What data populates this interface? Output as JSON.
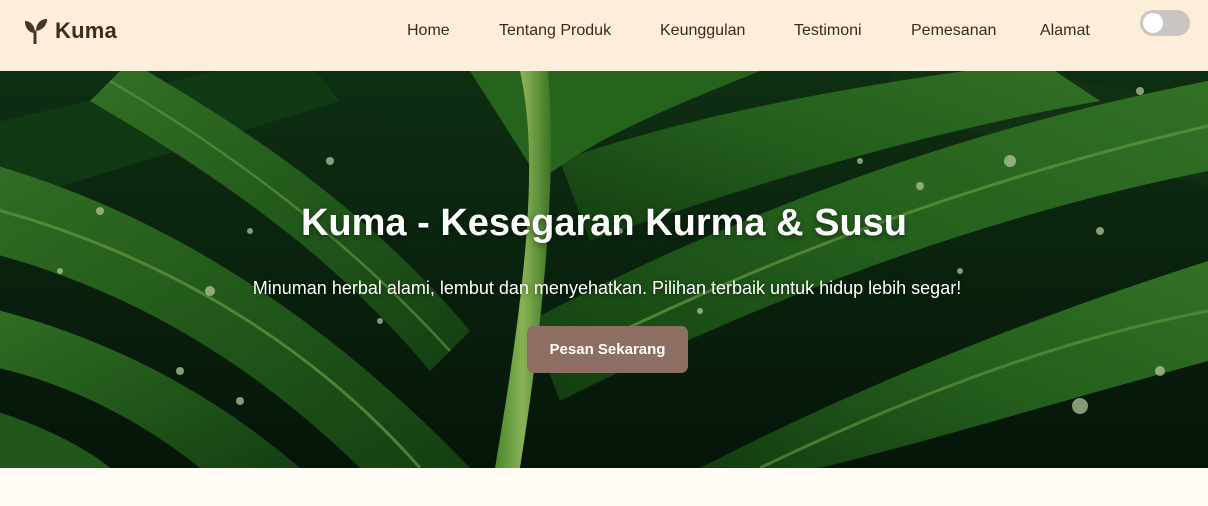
{
  "brand": {
    "name": "Kuma",
    "icon": "sprout-icon"
  },
  "nav": {
    "items": [
      {
        "label": "Home"
      },
      {
        "label": "Tentang Produk"
      },
      {
        "label": "Keunggulan"
      },
      {
        "label": "Testimoni"
      },
      {
        "label": "Pemesanan"
      },
      {
        "label": "Alamat"
      }
    ],
    "theme_toggle": {
      "state": "off"
    }
  },
  "hero": {
    "title": "Kuma - Kesegaran Kurma & Susu",
    "subtitle": "Minuman herbal alami, lembut dan menyehatkan. Pilihan terbaik untuk hidup lebih segar!",
    "cta_label": "Pesan Sekarang",
    "background_image": "palm-leaves-with-water-droplets"
  },
  "colors": {
    "navbar_bg": "#fdeedb",
    "brand_text": "#3f2b20",
    "cta_bg": "#8d6e63",
    "hero_text": "#ffffff",
    "page_bg": "#fffaf3"
  }
}
